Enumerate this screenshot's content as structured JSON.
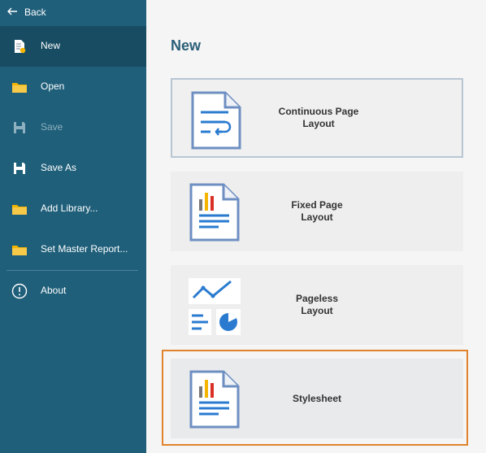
{
  "sidebar": {
    "back_label": "Back",
    "items": [
      {
        "label": "New",
        "icon": "new-document-icon"
      },
      {
        "label": "Open",
        "icon": "folder-icon"
      },
      {
        "label": "Save",
        "icon": "save-icon"
      },
      {
        "label": "Save As",
        "icon": "save-as-icon"
      },
      {
        "label": "Add Library...",
        "icon": "folder-icon"
      },
      {
        "label": "Set Master Report...",
        "icon": "folder-icon"
      },
      {
        "label": "About",
        "icon": "info-icon"
      }
    ]
  },
  "main": {
    "title": "New",
    "cards": [
      {
        "label": "Continuous Page\nLayout",
        "icon": "continuous-page-icon"
      },
      {
        "label": "Fixed Page\nLayout",
        "icon": "fixed-page-icon"
      },
      {
        "label": "Pageless\nLayout",
        "icon": "pageless-icon"
      },
      {
        "label": "Stylesheet",
        "icon": "stylesheet-icon"
      }
    ]
  },
  "colors": {
    "sidebar": "#1f5f7a",
    "sidebar_active": "#174c63",
    "accent": "#2b5f78",
    "highlight": "#e0832b",
    "icon_blue": "#2a7bd0",
    "folder": "#f4b400"
  }
}
